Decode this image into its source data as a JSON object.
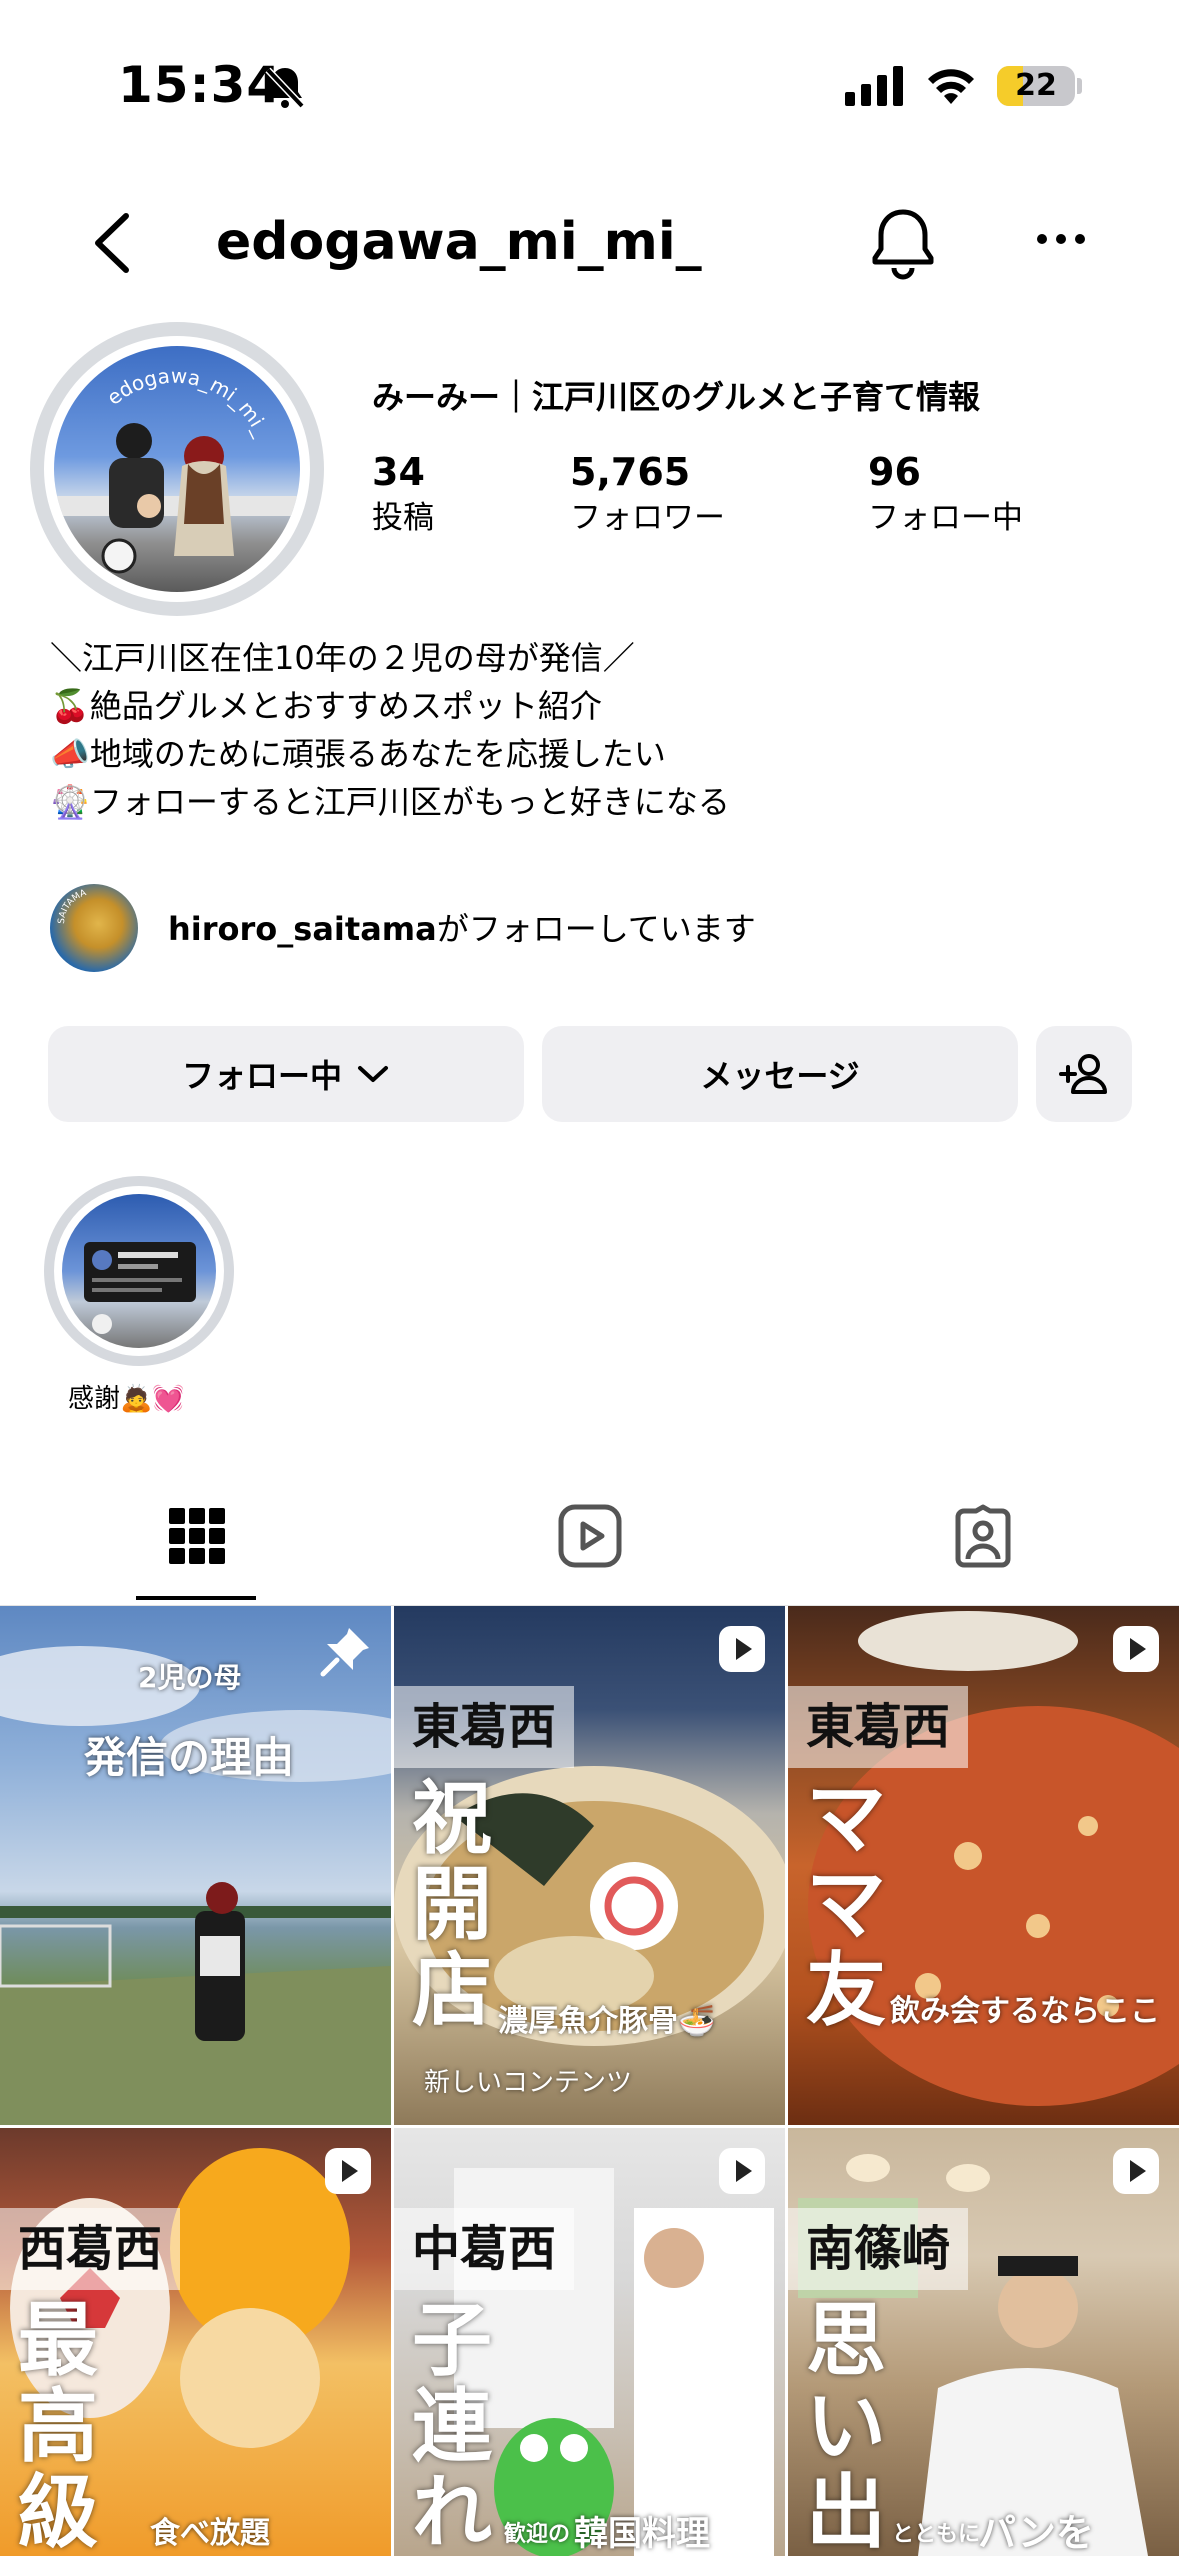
{
  "status_bar": {
    "time": "15:34",
    "battery": "22"
  },
  "header": {
    "username": "edogawa_mi_mi_"
  },
  "profile": {
    "avatar_text": "edogawa_mi_mi_",
    "display_name": "みーみー｜江戸川区のグルメと子育て情報",
    "stats": [
      {
        "value": "34",
        "label": "投稿"
      },
      {
        "value": "5,765",
        "label": "フォロワー"
      },
      {
        "value": "96",
        "label": "フォロー中"
      }
    ],
    "bio": [
      "＼江戸川区在住10年の２児の母が発信／",
      "🍒絶品グルメとおすすめスポット紹介",
      "📣地域のために頑張るあなたを応援したい",
      "🎡フォローすると江戸川区がもっと好きになる"
    ],
    "followed_by": {
      "user": "hiroro_saitama",
      "suffix": "がフォローしています",
      "avatar_text": "SAITAMA"
    }
  },
  "actions": {
    "following": "フォロー中",
    "message": "メッセージ"
  },
  "highlights": [
    {
      "label": "感謝🙇💓"
    }
  ],
  "grid": [
    {
      "small": "2児の母",
      "title": "発信の理由"
    },
    {
      "tag": "東葛西",
      "big": "祝開店",
      "sub": "濃厚魚介豚骨🍜",
      "caption": "新しいコンテンツ"
    },
    {
      "tag": "東葛西",
      "big": "ママ友",
      "sub": "飲み会するならここ"
    },
    {
      "tag": "西葛西",
      "big": "最高級",
      "sub": "食べ放題"
    },
    {
      "tag": "中葛西",
      "big": "子連れ",
      "sub_small": "歓迎の",
      "sub": "韓国料理"
    },
    {
      "tag": "南篠崎",
      "big": "思い出",
      "sub_small": "とともに",
      "sub": "パンを"
    }
  ],
  "colors": {
    "accent": "#f5cc2a",
    "button_bg": "#efeff2"
  }
}
